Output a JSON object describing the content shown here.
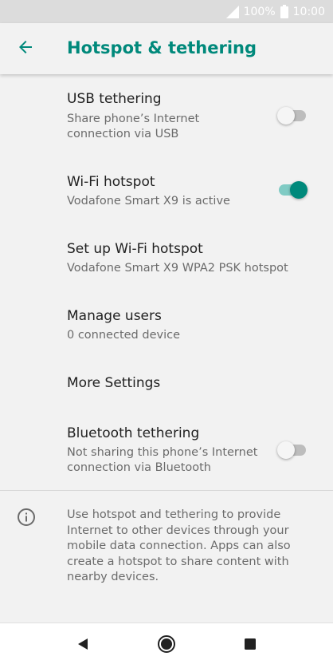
{
  "status_bar": {
    "battery_percent": "100%",
    "time": "10:00",
    "icons": [
      "signal-icon",
      "battery-icon"
    ]
  },
  "app_bar": {
    "back_icon": "arrow-back-icon",
    "title": "Hotspot & tethering"
  },
  "colors": {
    "accent": "#00897b",
    "accent_light": "#80cbc4",
    "background": "#f2f2f2",
    "status_bar": "#dcdcdc"
  },
  "preferences": [
    {
      "title": "USB tethering",
      "summary": "Share phone’s Internet connection via USB",
      "toggle": "off"
    },
    {
      "title": "Wi-Fi hotspot",
      "summary": "Vodafone Smart X9 is active",
      "toggle": "on"
    },
    {
      "title": "Set up Wi-Fi hotspot",
      "summary": "Vodafone Smart X9 WPA2 PSK hotspot"
    },
    {
      "title": "Manage users",
      "summary": "0 connected device"
    },
    {
      "title": "More Settings"
    },
    {
      "title": "Bluetooth tethering",
      "summary": "Not sharing this phone’s Internet connection via Bluetooth",
      "toggle": "off"
    }
  ],
  "footer_info": {
    "icon": "info-icon",
    "text": "Use hotspot and tethering to provide Internet to other devices through your mobile data connection. Apps can also create a hotspot to share content with nearby devices."
  },
  "nav_bar": {
    "icons": [
      "back-triangle-icon",
      "home-circle-icon",
      "recents-square-icon"
    ]
  }
}
